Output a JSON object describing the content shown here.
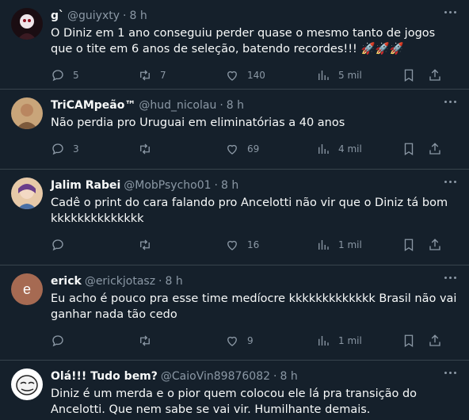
{
  "tweets": [
    {
      "name": "g`",
      "handle": "@guiyxty",
      "dot": "·",
      "time": "8 h",
      "text": "O Diniz em 1 ano conseguiu perder quase o mesmo tanto de jogos que o tite em 6 anos de seleção, batendo recordes!!! 🚀🚀🚀",
      "replies": "5",
      "retweets": "7",
      "likes": "140",
      "views": "5 mil",
      "avatar_color": "#1a0d12"
    },
    {
      "name": "TriCAMpeão™",
      "handle": "@hud_nicolau",
      "dot": "·",
      "time": "8 h",
      "text": "Não perdia pro Uruguai em eliminatórias a 40 anos",
      "replies": "3",
      "retweets": "",
      "likes": "69",
      "views": "4 mil",
      "avatar_color": "#c9a57a"
    },
    {
      "name": "Jalim Rabei",
      "handle": "@MobPsycho01",
      "dot": "·",
      "time": "8 h",
      "text": "Cadê o print do cara falando pro Ancelotti não vir que o Diniz tá bom kkkkkkkkkkkkkk",
      "replies": "",
      "retweets": "",
      "likes": "16",
      "views": "1 mil",
      "avatar_color": "#e7c9a8"
    },
    {
      "name": "erick",
      "handle": "@erickjotasz",
      "dot": "·",
      "time": "8 h",
      "text": "Eu acho é pouco pra esse time medíocre kkkkkkkkkkkkk Brasil não vai ganhar nada tão cedo",
      "replies": "",
      "retweets": "",
      "likes": "9",
      "views": "1 mil",
      "avatar_letter": "e",
      "avatar_color": "#a66a52"
    },
    {
      "name": "Olá!!! Tudo bem?",
      "handle": "@CaioVin89876082",
      "dot": "·",
      "time": "8 h",
      "text": "Diniz é um merda e o pior quem colocou ele lá pra transição do Ancelotti. Que nem sabe se vai vir. Humilhante demais.",
      "replies": "",
      "retweets": "",
      "likes": "",
      "views": "",
      "avatar_color": "#ffffff"
    }
  ]
}
